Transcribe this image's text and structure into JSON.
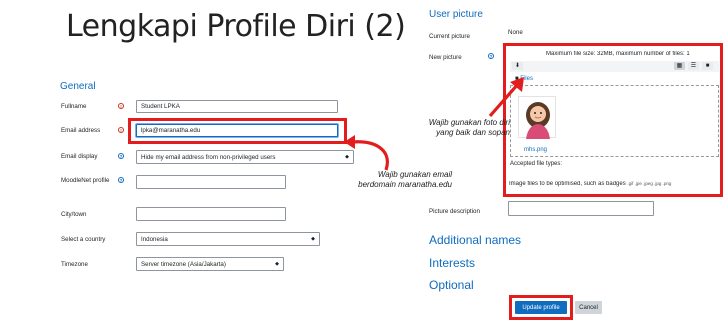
{
  "slide": {
    "title": "Lengkapi Profile Diri (2)"
  },
  "general": {
    "heading": "General",
    "fields": {
      "fullname": {
        "label": "Fullname",
        "value": "Student LPKA"
      },
      "email": {
        "label": "Email address",
        "value": "lpka@maranatha.edu"
      },
      "email_display": {
        "label": "Email display",
        "value": "Hide my email address from non-privileged users"
      },
      "moodlenet": {
        "label": "MoodleNet profile",
        "value": ""
      },
      "city": {
        "label": "City/town",
        "value": ""
      },
      "country": {
        "label": "Select a country",
        "value": "Indonesia"
      },
      "timezone": {
        "label": "Timezone",
        "value": "Server timezone (Asia/Jakarta)"
      }
    }
  },
  "user_picture": {
    "heading": "User picture",
    "current_label": "Current picture",
    "current_value": "None",
    "new_label": "New picture",
    "max_size_text": "Maximum file size: 32MB, maximum number of files: 1",
    "folder_label": "Files",
    "file_name": "mhs.png",
    "accepted_label": "Accepted file types:",
    "accepted_desc": "Image files to be optimised, such as badges",
    "accepted_ext": ".gif .jpe .jpeg .jpg .png",
    "description_label": "Picture description",
    "description_value": ""
  },
  "sections": {
    "additional_names": "Additional names",
    "interests": "Interests",
    "optional": "Optional"
  },
  "buttons": {
    "update": "Update profile",
    "cancel": "Cancel"
  },
  "annotations": {
    "photo_note_1": "Wajib gunakan foto diri",
    "photo_note_2": "yang baik dan sopan",
    "email_note_1": "Wajib gunakan email",
    "email_note_2": "berdomain maranatha.edu"
  },
  "colors": {
    "accent": "#0f6cbf",
    "highlight": "#e31d1d"
  }
}
